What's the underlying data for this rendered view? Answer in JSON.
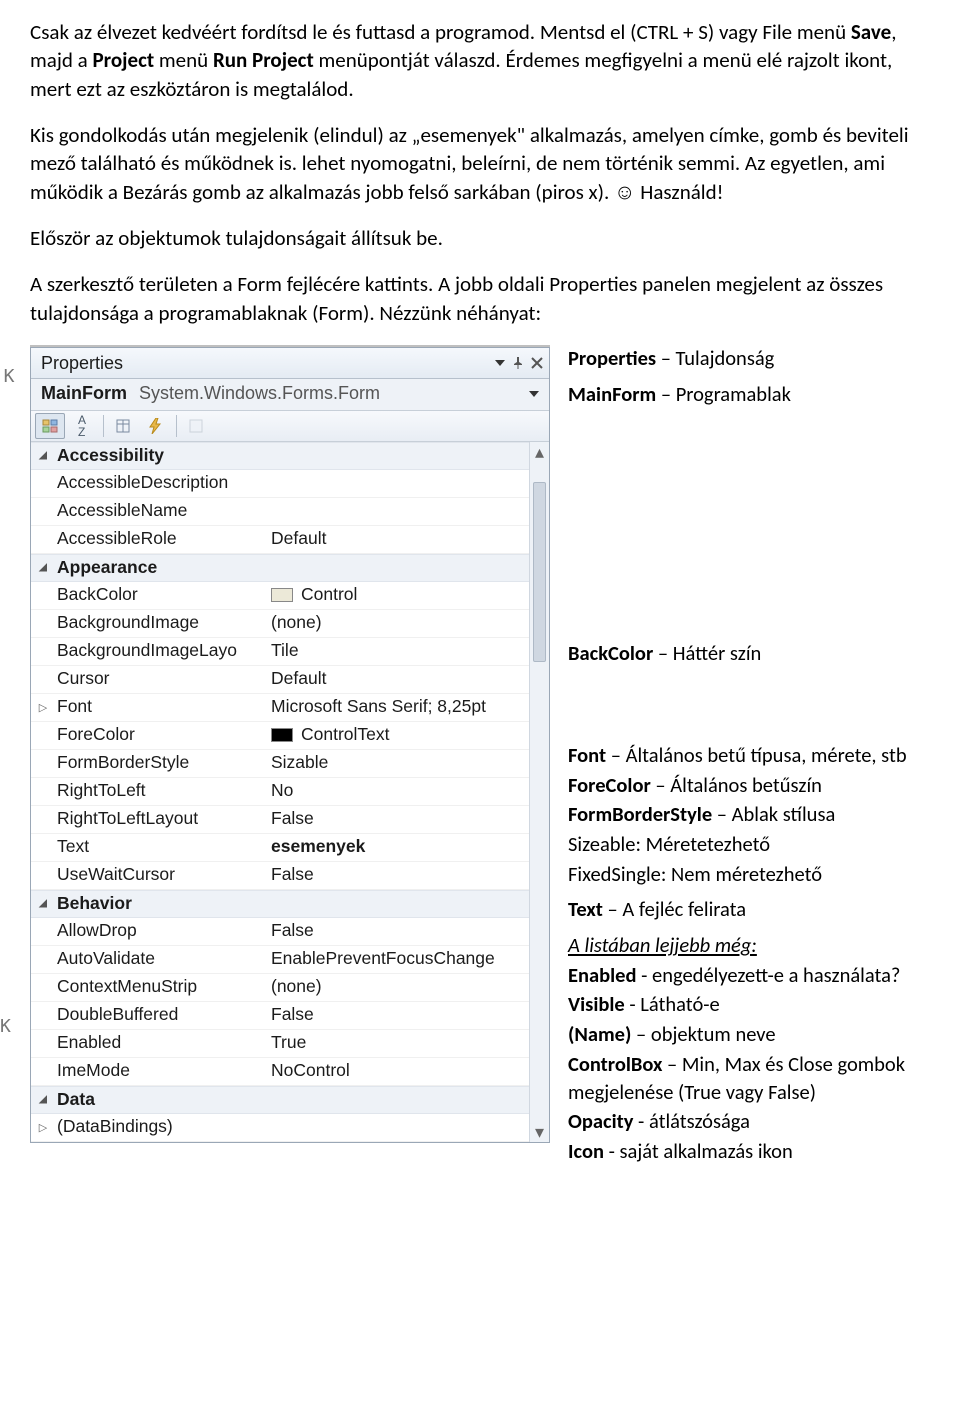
{
  "doc": {
    "p1a": "Csak az élvezet kedvéért fordítsd le és futtasd a programod. Mentsd el (CTRL + S) vagy File menü ",
    "p1b": "Save",
    "p1c": ", majd a ",
    "p1d": "Project",
    "p1e": " menü ",
    "p1f": "Run Project",
    "p1g": " menüpontját válaszd. Érdemes megfigyelni a menü elé rajzolt ikont, mert ezt az eszköztáron is megtalálod.",
    "p2": "Kis gondolkodás után megjelenik (elindul) az „esemenyek\" alkalmazás, amelyen címke, gomb és beviteli mező található és működnek is. lehet nyomogatni, beleírni, de nem történik semmi. Az egyetlen, ami működik a Bezárás gomb az alkalmazás jobb felső sarkában (piros x). ☺ Használd!",
    "p3": "Először az objektumok tulajdonságait állítsuk be.",
    "p4": "A szerkesztő területen a Form fejlécére kattints. A jobb oldali Properties panelen megjelent az összes tulajdonsága a programablaknak (Form). Nézzünk néhányat:"
  },
  "panel": {
    "title": "Properties",
    "object_name": "MainForm",
    "object_type": "System.Windows.Forms.Form",
    "categories": [
      {
        "name": "Accessibility",
        "rows": [
          {
            "name": "AccessibleDescription",
            "value": ""
          },
          {
            "name": "AccessibleName",
            "value": ""
          },
          {
            "name": "AccessibleRole",
            "value": "Default"
          }
        ]
      },
      {
        "name": "Appearance",
        "rows": [
          {
            "name": "BackColor",
            "value": "Control",
            "swatch": "ctrl"
          },
          {
            "name": "BackgroundImage",
            "value": "(none)"
          },
          {
            "name": "BackgroundImageLayo",
            "value": "Tile"
          },
          {
            "name": "Cursor",
            "value": "Default"
          },
          {
            "name": "Font",
            "value": "Microsoft Sans Serif; 8,25pt",
            "expandable": true
          },
          {
            "name": "ForeColor",
            "value": "ControlText",
            "swatch": "black"
          },
          {
            "name": "FormBorderStyle",
            "value": "Sizable"
          },
          {
            "name": "RightToLeft",
            "value": "No"
          },
          {
            "name": "RightToLeftLayout",
            "value": "False"
          },
          {
            "name": "Text",
            "value": "esemenyek",
            "bold": true
          },
          {
            "name": "UseWaitCursor",
            "value": "False"
          }
        ]
      },
      {
        "name": "Behavior",
        "rows": [
          {
            "name": "AllowDrop",
            "value": "False"
          },
          {
            "name": "AutoValidate",
            "value": "EnablePreventFocusChange"
          },
          {
            "name": "ContextMenuStrip",
            "value": "(none)"
          },
          {
            "name": "DoubleBuffered",
            "value": "False"
          },
          {
            "name": "Enabled",
            "value": "True"
          },
          {
            "name": "ImeMode",
            "value": "NoControl"
          }
        ]
      },
      {
        "name": "Data",
        "rows": [
          {
            "name": "(DataBindings)",
            "value": "",
            "expandable": true
          }
        ]
      }
    ]
  },
  "ann": {
    "a1a": "Properties",
    "a1b": " – Tulajdonság",
    "a2a": "MainForm",
    "a2b": " – Programablak",
    "a3a": "BackColor",
    "a3b": " – Háttér szín",
    "a4a": "Font",
    "a4b": " – Általános betű típusa, mérete, stb",
    "a5a": "ForeColor",
    "a5b": " – Általános betűszín",
    "a6a": "FormBorderStyle",
    "a6b": " – Ablak stílusa",
    "a7": "Sizeable: Méretetezhető",
    "a8": "FixedSingle: Nem méretezhető",
    "a9a": "Text",
    "a9b": " – A fejléc felirata",
    "a10": "A listában lejjebb még:",
    "a11a": "Enabled",
    "a11b": " - engedélyezett-e a használata?",
    "a12a": "Visible",
    "a12b": " - Látható-e",
    "a13a": "(Name)",
    "a13b": " – objektum neve",
    "a14a": "ControlBox",
    "a14b": " – Min, Max és Close gombok megjelenése (True vagy False)",
    "a15a": "Opacity",
    "a15b": " - átlátszósága",
    "a16a": "Icon",
    "a16b": " - saját alkalmazás ikon"
  },
  "stubs": {
    "k": "K",
    "k2": "K"
  }
}
